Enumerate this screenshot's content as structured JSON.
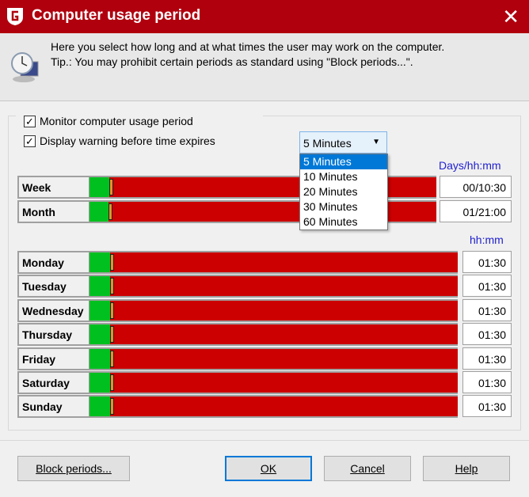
{
  "window": {
    "title": "Computer usage period",
    "close_icon": "close-icon",
    "logo": "G"
  },
  "header": {
    "line1": "Here you select how long and at what times the user may work on the computer.",
    "line2": "Tip.: You may prohibit certain periods as standard using \"Block periods...\".",
    "icon": "clock-computer-icon"
  },
  "options": {
    "monitor_label": "Monitor computer usage period",
    "monitor_checked": true,
    "warning_label": "Display warning before time expires",
    "warning_checked": true
  },
  "warning_select": {
    "value": "5 Minutes",
    "options": [
      "5 Minutes",
      "10 Minutes",
      "20 Minutes",
      "30 Minutes",
      "60 Minutes"
    ],
    "selected_index": 0
  },
  "periods": {
    "unit": "Days/hh:mm",
    "rows": [
      {
        "label": "Week",
        "value": "00/10:30",
        "allowed_fraction": 0.0625
      },
      {
        "label": "Month",
        "value": "01/21:00",
        "allowed_fraction": 0.06
      }
    ]
  },
  "days": {
    "unit": "hh:mm",
    "rows": [
      {
        "label": "Monday",
        "value": "01:30",
        "allowed_fraction": 0.0625
      },
      {
        "label": "Tuesday",
        "value": "01:30",
        "allowed_fraction": 0.0625
      },
      {
        "label": "Wednesday",
        "value": "01:30",
        "allowed_fraction": 0.0625
      },
      {
        "label": "Thursday",
        "value": "01:30",
        "allowed_fraction": 0.0625
      },
      {
        "label": "Friday",
        "value": "01:30",
        "allowed_fraction": 0.0625
      },
      {
        "label": "Saturday",
        "value": "01:30",
        "allowed_fraction": 0.0625
      },
      {
        "label": "Sunday",
        "value": "01:30",
        "allowed_fraction": 0.0625
      }
    ]
  },
  "colors": {
    "titlebar": "#b0000e",
    "allowed": "#00c020",
    "blocked": "#cc0000",
    "handle": "#e8902a",
    "unit_text": "#2020d0"
  },
  "buttons": {
    "block": "Block periods...",
    "ok": "OK",
    "cancel": "Cancel",
    "help": "Help"
  }
}
